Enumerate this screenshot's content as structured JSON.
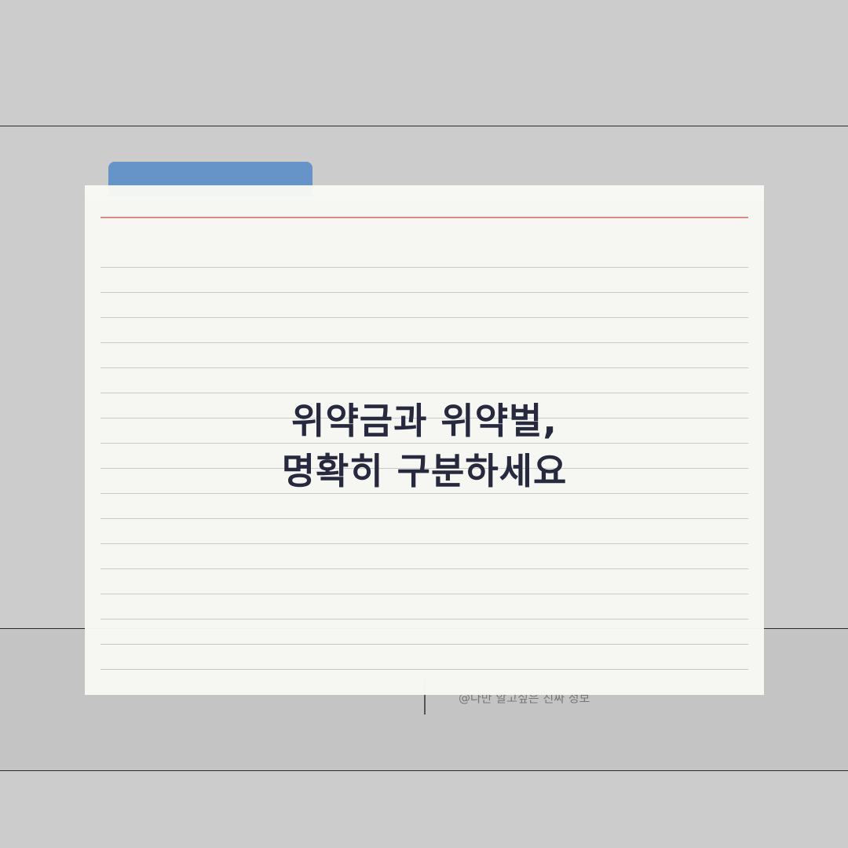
{
  "title": {
    "line1": "위약금과 위약벌,",
    "line2": "명확히 구분하세요"
  },
  "credit": {
    "text": "@나만 알고싶은 진짜 정보"
  },
  "colors": {
    "background": "#cccccc",
    "folder_tab": "#6694c9",
    "card": "#f8f8f4",
    "margin_line": "#d98b8b",
    "title_text": "#22243a"
  }
}
